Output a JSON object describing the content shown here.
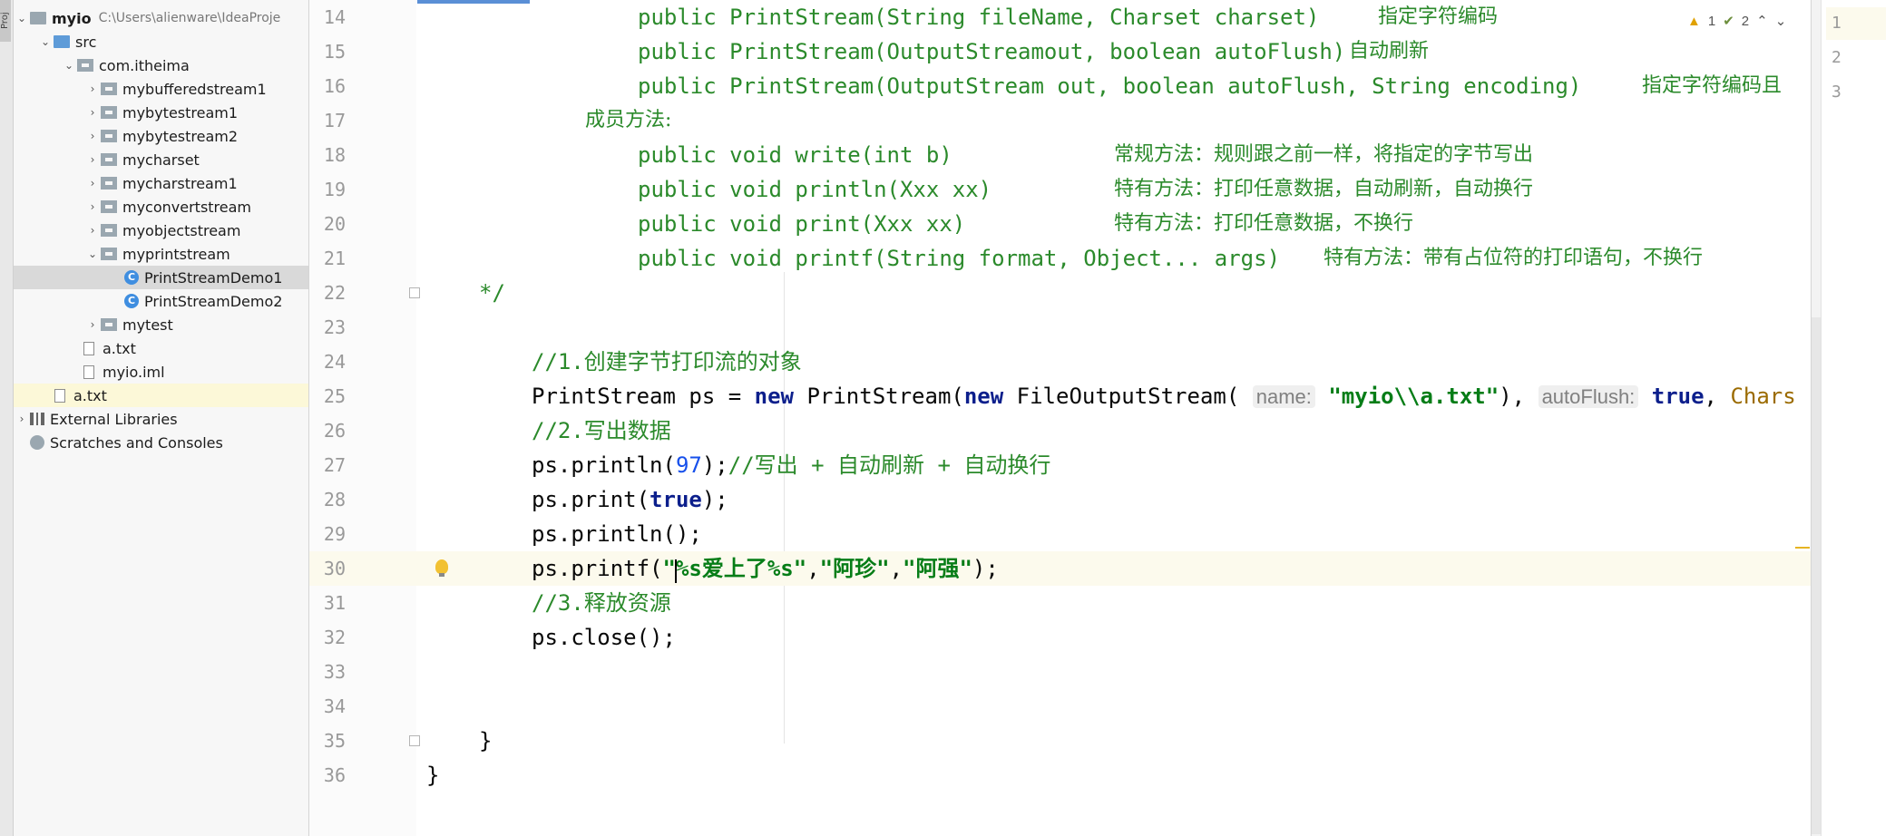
{
  "project": {
    "root_name": "myio",
    "root_path": "C:\\Users\\alienware\\IdeaProje",
    "src": "src",
    "package": "com.itheima",
    "folders": [
      "mybufferedstream1",
      "mybytestream1",
      "mybytestream2",
      "mycharset",
      "mycharstream1",
      "myconvertstream",
      "myobjectstream",
      "myprintstream"
    ],
    "classes": [
      "PrintStreamDemo1",
      "PrintStreamDemo2"
    ],
    "mytest": "mytest",
    "files": [
      "a.txt",
      "myio.iml"
    ],
    "root_file": "a.txt",
    "external_libraries": "External Libraries",
    "scratches": "Scratches and Consoles",
    "side_tab": "Proj"
  },
  "inspections": {
    "warnings": "1",
    "weak_warnings": "2"
  },
  "code_lines": {
    "l14": {
      "n": "14",
      "code": "public PrintStream(String fileName, Charset charset)",
      "comment": "指定字符编码"
    },
    "l15": {
      "n": "15",
      "code": "public PrintStream(OutputStreamout, boolean autoFlush)",
      "comment": "自动刷新"
    },
    "l16": {
      "n": "16",
      "code": "public PrintStream(OutputStream out, boolean autoFlush, String encoding)",
      "comment": "指定字符编码且"
    },
    "l17": {
      "n": "17",
      "code": "成员方法:"
    },
    "l18": {
      "n": "18",
      "code": "public void write(int b)",
      "comment": "常规方法：规则跟之前一样，将指定的字节写出"
    },
    "l19": {
      "n": "19",
      "code": "public void println(Xxx xx)",
      "comment": "特有方法：打印任意数据，自动刷新，自动换行"
    },
    "l20": {
      "n": "20",
      "code": "public void print(Xxx xx)",
      "comment": "特有方法：打印任意数据，不换行"
    },
    "l21": {
      "n": "21",
      "code": "public void printf(String format, Object... args)",
      "comment": "特有方法：带有占位符的打印语句，不换行"
    },
    "l22": {
      "n": "22",
      "code": "*/"
    },
    "l23": {
      "n": "23"
    },
    "l24": {
      "n": "24",
      "code": "//1.创建字节打印流的对象"
    },
    "l25": {
      "n": "25",
      "p1": "PrintStream ps = ",
      "kw_new": "new",
      "p2": " PrintStream(",
      "p3": " FileOutputStream(",
      "hint_name": "name:",
      "str_path": "\"myio\\\\a.txt\"",
      "p4": "),",
      "hint_flush": "autoFlush:",
      "kw_true": "true",
      "p5": ", ",
      "tail": "Chars"
    },
    "l26": {
      "n": "26",
      "code": "//2.写出数据"
    },
    "l27": {
      "n": "27",
      "p1": "ps.println(",
      "num": "97",
      "p2": ");",
      "comment": "//写出 + 自动刷新 + 自动换行"
    },
    "l28": {
      "n": "28",
      "p1": "ps.print(",
      "kw": "true",
      "p2": ");"
    },
    "l29": {
      "n": "29",
      "code": "ps.println();"
    },
    "l30": {
      "n": "30",
      "p1": "ps.printf(",
      "s1": "\"%s爱上了%s\"",
      "c1": ",",
      "s2": "\"阿珍\"",
      "c2": ",",
      "s3": "\"阿强\"",
      "p2": ");"
    },
    "l31": {
      "n": "31",
      "code": "//3.释放资源"
    },
    "l32": {
      "n": "32",
      "code": "ps.close();"
    },
    "l33": {
      "n": "33"
    },
    "l34": {
      "n": "34"
    },
    "l35": {
      "n": "35",
      "code": "}"
    },
    "l36": {
      "n": "36",
      "code": "}"
    }
  },
  "right_panel": {
    "lines": [
      "1",
      "2",
      "3"
    ]
  }
}
